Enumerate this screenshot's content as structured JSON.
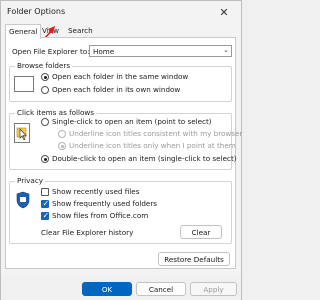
{
  "window": {
    "title": "Folder Options"
  },
  "tabs": [
    {
      "label": "General"
    },
    {
      "label": "View"
    },
    {
      "label": "Search"
    }
  ],
  "general": {
    "open_explorer_label": "Open File Explorer to:",
    "open_explorer_value": "Home",
    "browse_folders": {
      "title": "Browse folders",
      "opt_same": "Open each folder in the same window",
      "opt_own": "Open each folder in its own window"
    },
    "click_items": {
      "title": "Click items as follows",
      "opt_single": "Single-click to open an item (point to select)",
      "opt_underline_browser": "Underline icon titles consistent with my browser",
      "opt_underline_point": "Underline icon titles only when I point at them",
      "opt_double": "Double-click to open an item (single-click to select)"
    },
    "privacy": {
      "title": "Privacy",
      "show_recent": "Show recently used files",
      "show_frequent": "Show frequently used folders",
      "show_office": "Show files from Office.com",
      "clear_history_label": "Clear File Explorer history",
      "clear_button": "Clear"
    },
    "restore_defaults": "Restore Defaults"
  },
  "footer": {
    "ok": "OK",
    "cancel": "Cancel",
    "apply": "Apply"
  },
  "colors": {
    "accent": "#0067c0",
    "check": "#1565c0"
  }
}
